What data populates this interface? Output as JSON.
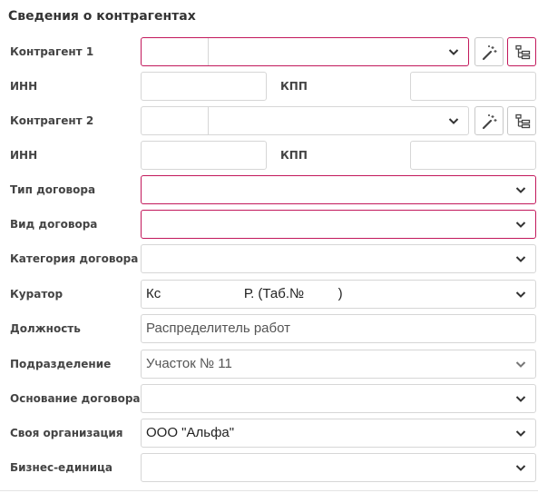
{
  "section": {
    "title": "Сведения о контрагентах"
  },
  "counterparty1": {
    "label": "Контрагент 1"
  },
  "inn1": {
    "label": "ИНН",
    "kpp_label": "КПП"
  },
  "counterparty2": {
    "label": "Контрагент 2"
  },
  "inn2": {
    "label": "ИНН",
    "kpp_label": "КПП"
  },
  "contract_type": {
    "label": "Тип договора",
    "value": ""
  },
  "contract_kind": {
    "label": "Вид договора",
    "value": ""
  },
  "contract_category": {
    "label": "Категория договора",
    "value": ""
  },
  "curator": {
    "label": "Куратор",
    "value": "Кс                      Р. (Таб.№         )"
  },
  "position": {
    "label": "Должность",
    "value": "Распределитель работ"
  },
  "department": {
    "label": "Подразделение",
    "value": "Участок № 11"
  },
  "contract_basis": {
    "label": "Основание договора",
    "value": ""
  },
  "own_org": {
    "label": "Своя организация",
    "value": "ООО \"Альфа\""
  },
  "business_unit": {
    "label": "Бизнес-единица",
    "value": ""
  },
  "colors": {
    "required_border": "#c2185b",
    "border": "#d6d6d6"
  },
  "icons": [
    "magic-wand-icon",
    "tree-list-icon",
    "chevron-down-icon"
  ]
}
